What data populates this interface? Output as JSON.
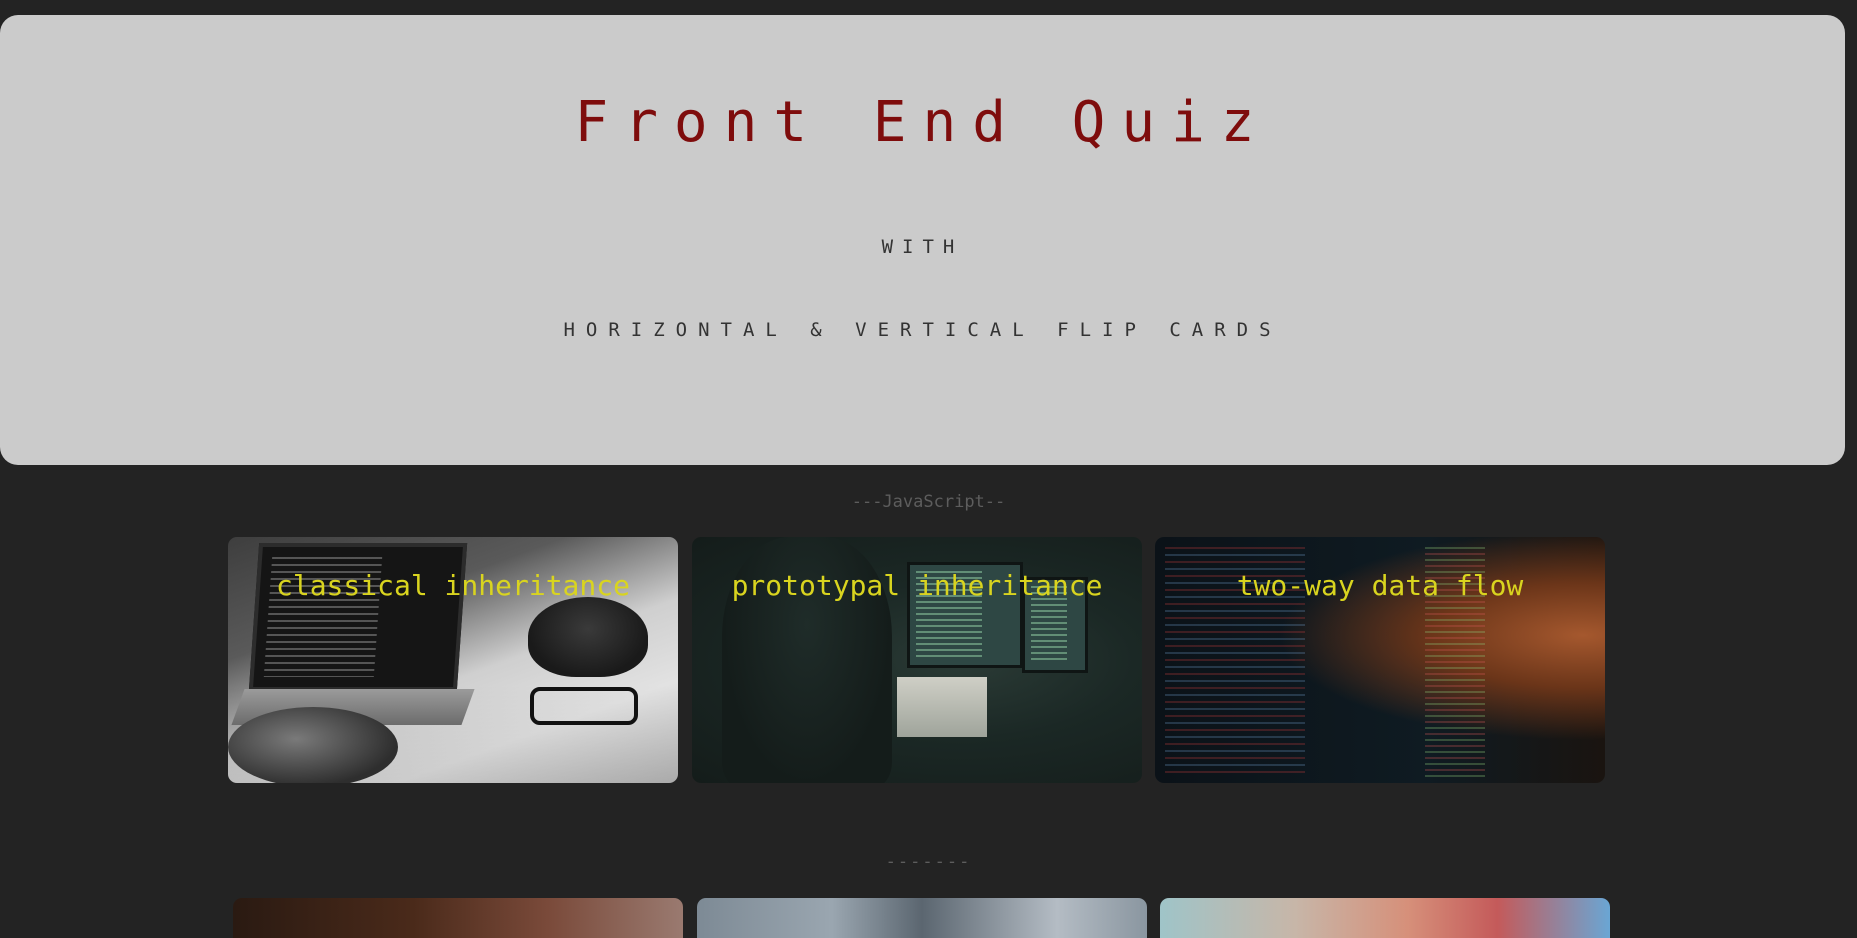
{
  "hero": {
    "title": "Front End Quiz",
    "with": "WITH",
    "subtitle": "HORIZONTAL & VERTICAL FLIP CARDS"
  },
  "sections": [
    {
      "label": "---JavaScript--",
      "cards": [
        {
          "label": "classical inheritance"
        },
        {
          "label": "prototypal inheritance"
        },
        {
          "label": "two-way data flow"
        }
      ]
    },
    {
      "label": "-------"
    }
  ],
  "colors": {
    "page_background": "#232323",
    "hero_background": "#cbcbcb",
    "title": "#7e0c0c",
    "card_label": "#d9d41f",
    "section_label": "#5d5d5d"
  }
}
